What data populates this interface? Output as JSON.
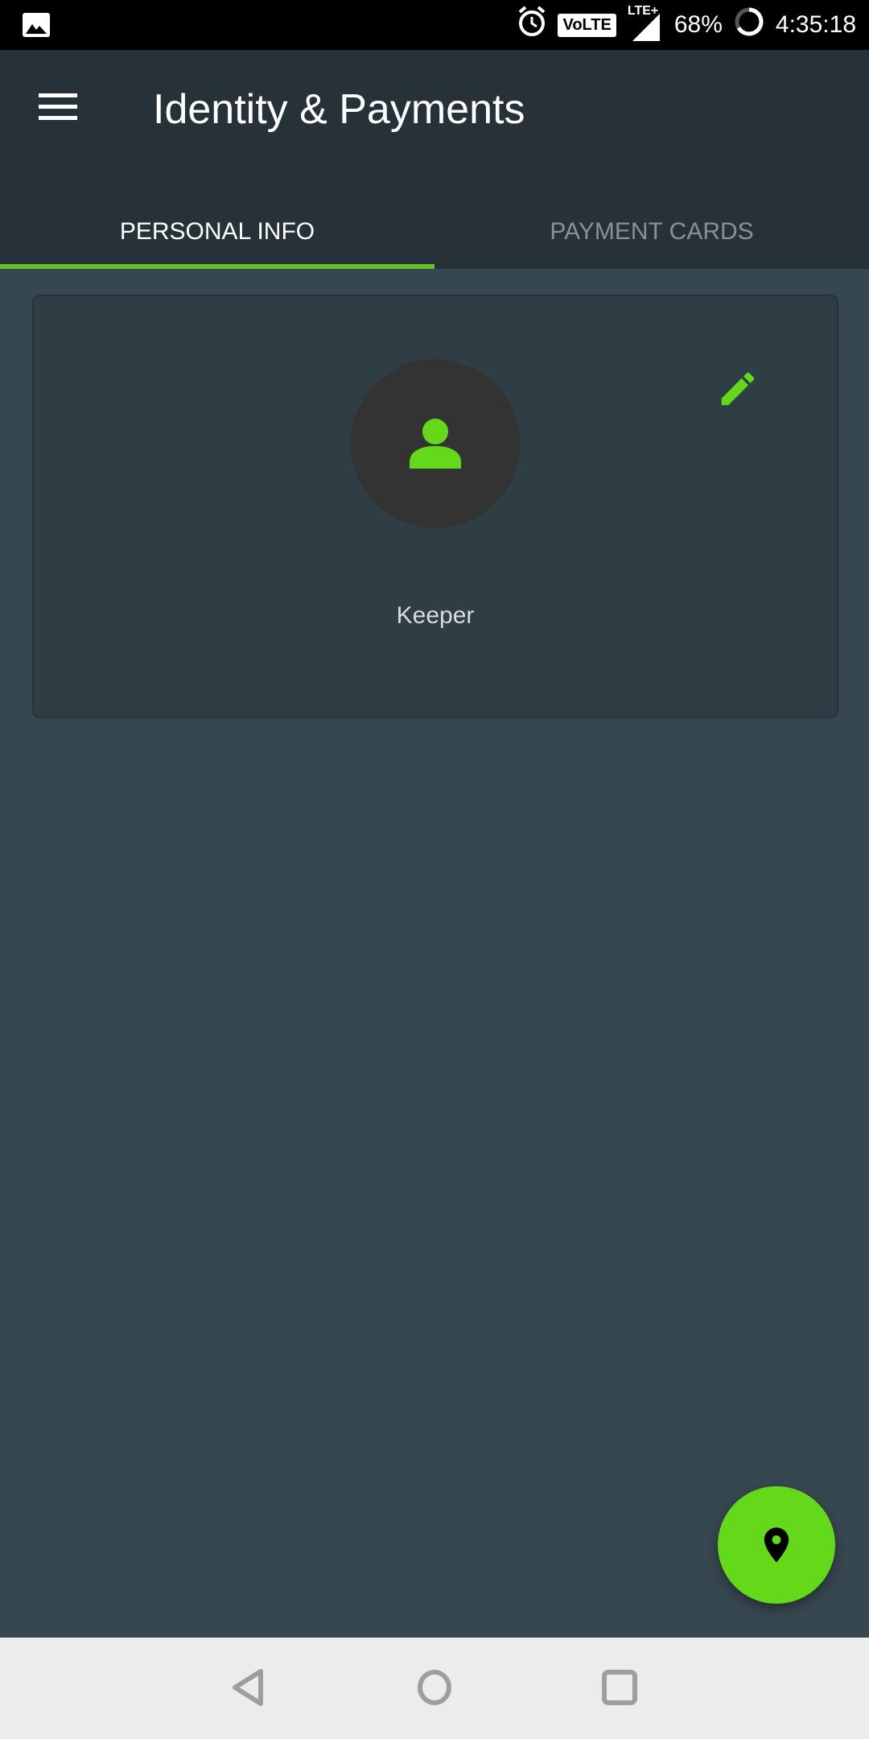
{
  "status_bar": {
    "left_icon": "image-icon",
    "icons": [
      "alarm-icon",
      "volte-icon",
      "lte-plus-signal-icon",
      "battery-ring-icon"
    ],
    "volte_label": "VoLTE",
    "network_label": "LTE+",
    "battery": "68%",
    "time": "4:35:18"
  },
  "appbar": {
    "menu_icon": "hamburger-menu-icon",
    "title": "Identity & Payments"
  },
  "tabs": [
    {
      "label": "PERSONAL INFO",
      "active": true
    },
    {
      "label": "PAYMENT CARDS",
      "active": false
    }
  ],
  "card": {
    "avatar_icon": "person-icon",
    "edit_icon": "pencil-icon",
    "name": "Keeper"
  },
  "fab": {
    "icon": "location-pin-icon"
  },
  "navbar": {
    "buttons": [
      "back",
      "home",
      "recents"
    ]
  },
  "colors": {
    "accent": "#63d919",
    "appbar": "#263238",
    "background": "#37474f",
    "card": "#2f3d45"
  }
}
